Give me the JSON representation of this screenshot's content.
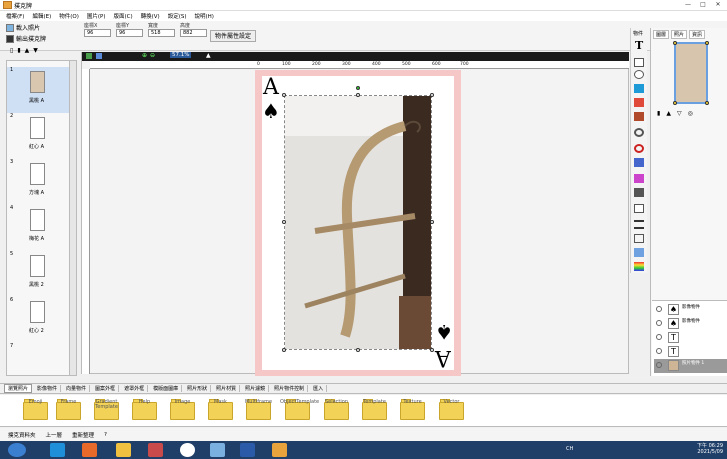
{
  "window": {
    "title": "撲克牌",
    "btn_min": "—",
    "btn_max": "□",
    "btn_close": "✕"
  },
  "menu": [
    "檔案(F)",
    "編輯(E)",
    "物件(O)",
    "圖片(P)",
    "版面(C)",
    "轉換(V)",
    "設定(S)",
    "說明(H)"
  ],
  "toolbar": {
    "import_photo": "載入照片",
    "export_card": "輸出撲克牌",
    "fields": [
      {
        "label": "座標X",
        "value": "96"
      },
      {
        "label": "座標Y",
        "value": "96"
      },
      {
        "label": "寬度",
        "value": "518"
      },
      {
        "label": "高度",
        "value": "882"
      }
    ],
    "unit": "px",
    "attr_button": "物件屬性設定",
    "zoom": "57.1%"
  },
  "ruler": {
    "h": [
      "0",
      "100",
      "200",
      "300",
      "400",
      "500",
      "600",
      "700"
    ]
  },
  "slides": [
    {
      "num": "1",
      "label": "黑桃 A",
      "selected": true
    },
    {
      "num": "2",
      "label": "紅心 A"
    },
    {
      "num": "3",
      "label": "方塊 A"
    },
    {
      "num": "4",
      "label": "梅花 A"
    },
    {
      "num": "5",
      "label": "黑桃 2"
    },
    {
      "num": "6",
      "label": "紅心 2"
    },
    {
      "num": "7",
      "label": ""
    }
  ],
  "card": {
    "rank": "A",
    "suit": "♠",
    "rank_bottom": "A",
    "suit_bottom": "♠"
  },
  "right_panel": {
    "tabs": [
      "圖層",
      "照片",
      "資訊"
    ],
    "tab_label": "物件"
  },
  "layers": [
    {
      "name": "影像物件",
      "glyph": "♠"
    },
    {
      "name": "影像物件",
      "glyph": "♠"
    },
    {
      "name": "",
      "glyph": "T"
    },
    {
      "name": "",
      "glyph": "T"
    },
    {
      "name": "照片物件 1",
      "glyph": ""
    }
  ],
  "bottom_tabs": [
    "瀏覽照片",
    "影像物件",
    "向量物件",
    "圖案外框",
    "遮罩外框",
    "模版面圖庫",
    "照片形狀",
    "照片材質",
    "照片濾鏡",
    "照片物件控制",
    "匯入"
  ],
  "folders": [
    "Emoji",
    "Frame",
    "Gradient Template",
    "Help",
    "Image",
    "Mask",
    "Multiframe",
    "ObjectTemplate",
    "Selection",
    "Template",
    "Texture",
    "Vector"
  ],
  "status": {
    "resource": "撲克資料夾",
    "up": "上一層",
    "refresh": "重新整理",
    "question": "?"
  },
  "taskbar": {
    "lang": "CH",
    "time": "下午 06:29",
    "date": "2021/5/09"
  },
  "colors": {
    "card_border": "#f5c7c7",
    "taskbar": "#1f3f69",
    "folder": "#f2d257"
  }
}
